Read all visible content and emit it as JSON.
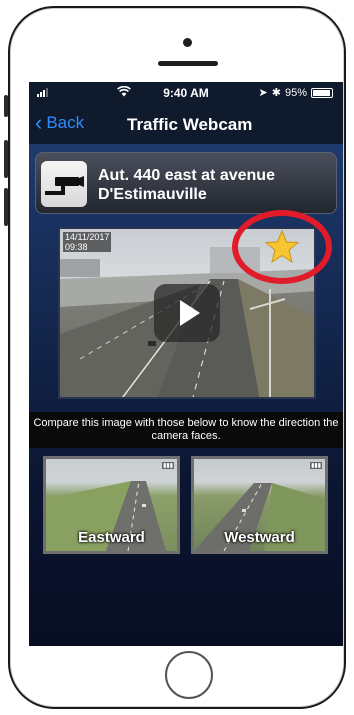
{
  "statusbar": {
    "time": "9:40 AM",
    "battery": "95%",
    "battery_level": 0.95,
    "icons": [
      "signal-icon",
      "wifi-icon",
      "location-icon",
      "bluetooth-icon",
      "battery-icon"
    ]
  },
  "navbar": {
    "back_label": "Back",
    "title": "Traffic Webcam"
  },
  "camera": {
    "title": "Aut. 440 east at avenue D'Estimauville",
    "icon": "traffic-camera-icon",
    "photo_date": "14/11/2017",
    "photo_time": "09:38",
    "favorite": true,
    "favorite_color": "#f7c531",
    "highlight_color": "#e01b2a"
  },
  "hint": "Compare this image with those below to know the direction the camera faces.",
  "directions": [
    {
      "label": "Eastward"
    },
    {
      "label": "Westward"
    }
  ],
  "colors": {
    "nav_background": "#0f1a2c",
    "back_link": "#2f8cff",
    "content_background": "#1e3a6e"
  }
}
